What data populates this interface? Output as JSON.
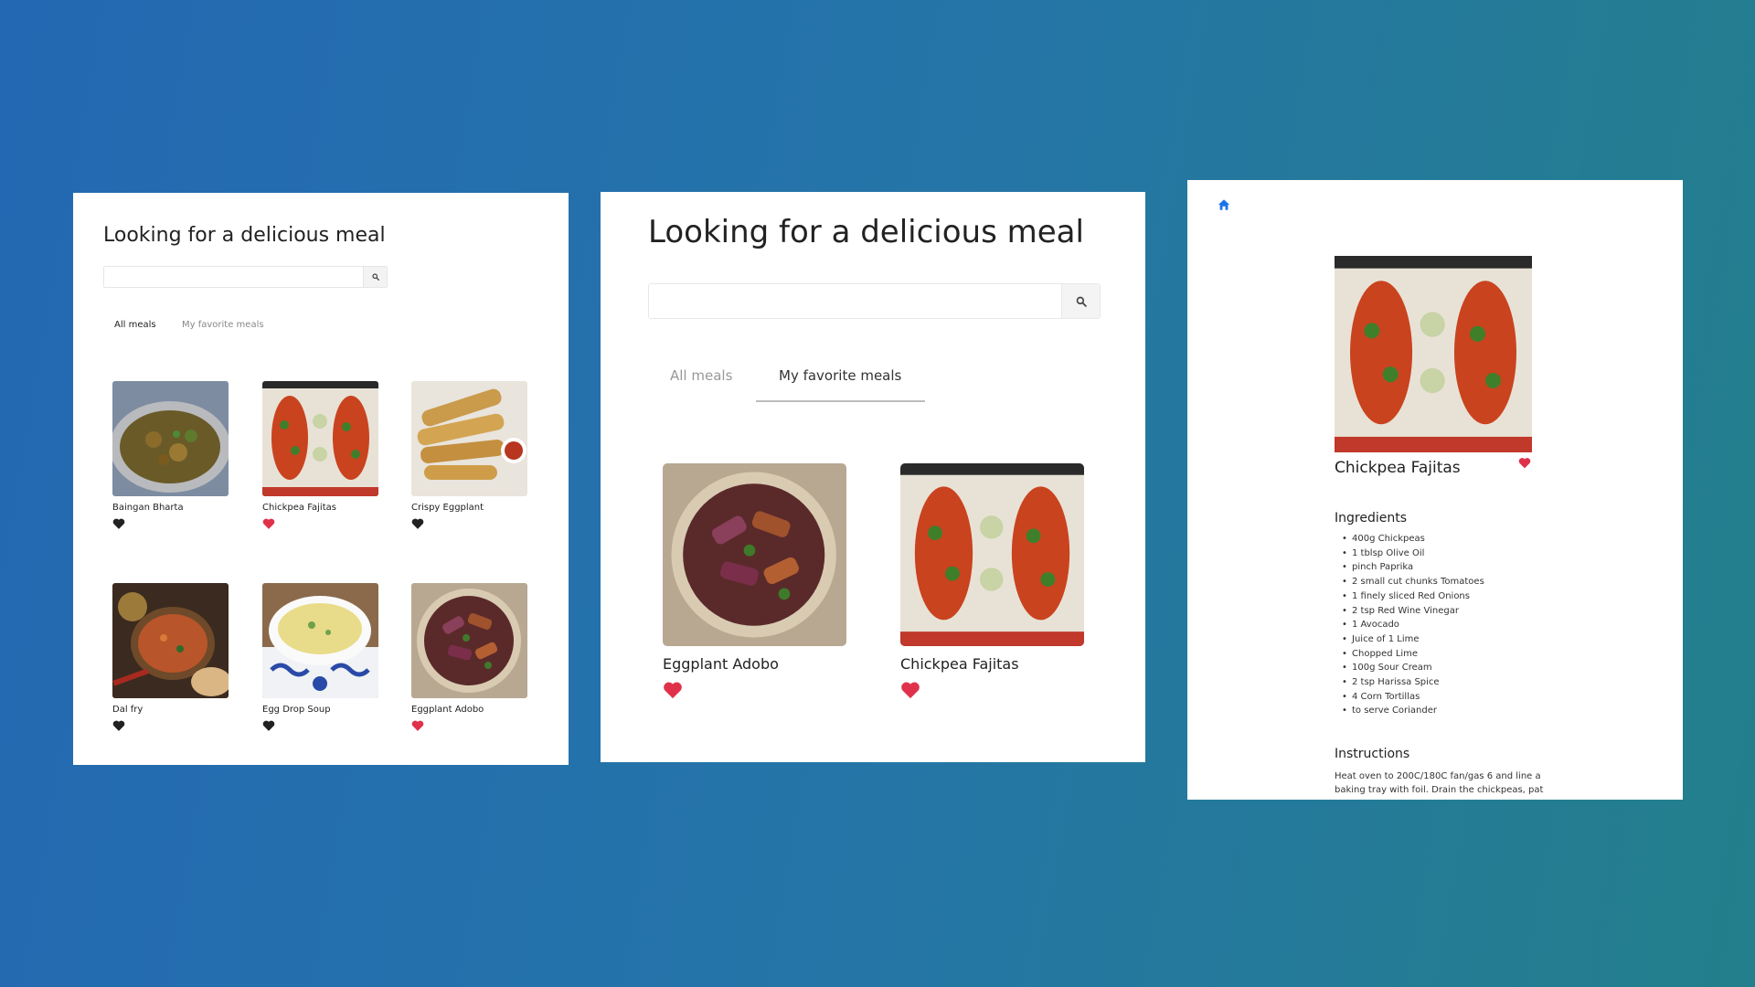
{
  "colors": {
    "accent": "#1a73e8",
    "heart_fav": "#e0314b",
    "heart_plain": "#222222"
  },
  "icons": {
    "search": "search-icon",
    "heart": "heart-icon",
    "home": "home-icon"
  },
  "list_page": {
    "title": "Looking for a delicious meal",
    "search": {
      "value": "",
      "placeholder": ""
    },
    "tabs": [
      {
        "label": "All meals",
        "active": true
      },
      {
        "label": "My favorite meals",
        "active": false
      }
    ],
    "meals": [
      {
        "name": "Baingan Bharta",
        "favorite": false,
        "image": "baingan"
      },
      {
        "name": "Chickpea Fajitas",
        "favorite": true,
        "image": "fajitas"
      },
      {
        "name": "Crispy Eggplant",
        "favorite": false,
        "image": "crispy"
      },
      {
        "name": "Dal fry",
        "favorite": false,
        "image": "dal"
      },
      {
        "name": "Egg Drop Soup",
        "favorite": false,
        "image": "soup"
      },
      {
        "name": "Eggplant Adobo",
        "favorite": true,
        "image": "adobo"
      }
    ]
  },
  "favorites_page": {
    "title": "Looking for a delicious meal",
    "search": {
      "value": "",
      "placeholder": ""
    },
    "tabs": [
      {
        "label": "All meals",
        "active": false
      },
      {
        "label": "My favorite meals",
        "active": true
      }
    ],
    "meals": [
      {
        "name": "Eggplant Adobo",
        "favorite": true,
        "image": "adobo"
      },
      {
        "name": "Chickpea Fajitas",
        "favorite": true,
        "image": "fajitas"
      }
    ]
  },
  "detail_page": {
    "meal_name": "Chickpea Fajitas",
    "favorite": true,
    "ingredients_heading": "Ingredients",
    "ingredients": [
      "400g Chickpeas",
      "1 tblsp Olive Oil",
      "pinch Paprika",
      "2 small cut chunks Tomatoes",
      "1 finely sliced Red Onions",
      "2 tsp Red Wine Vinegar",
      "1 Avocado",
      "Juice of 1 Lime",
      "Chopped Lime",
      "100g Sour Cream",
      "2 tsp Harissa Spice",
      "4 Corn Tortillas",
      "to serve Coriander"
    ],
    "instructions_heading": "Instructions",
    "instructions_text": "Heat oven to 200C/180C fan/gas 6 and line a baking tray with foil. Drain the chickpeas, pat"
  }
}
